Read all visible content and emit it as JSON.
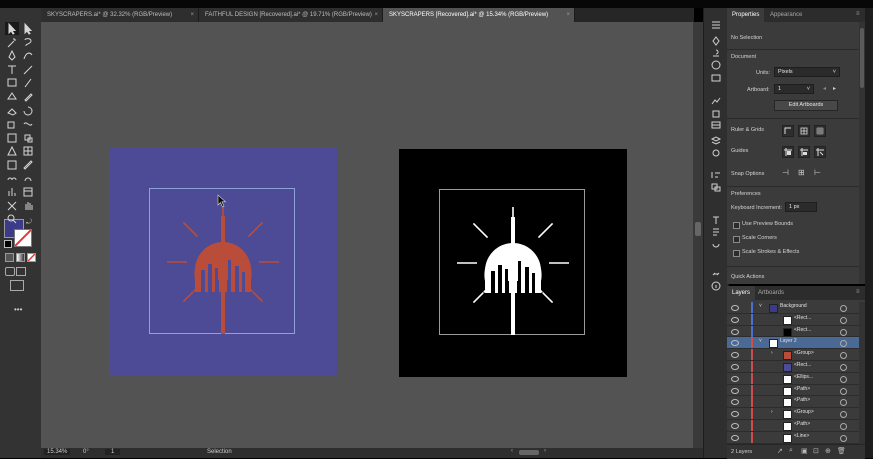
{
  "tabs": [
    {
      "label": "SKYSCRAPERS.ai* @ 32.32% (RGB/Preview)",
      "active": false
    },
    {
      "label": "FAITHFUL DESIGN [Recovered].ai* @ 19.71% (RGB/Preview)",
      "active": false
    },
    {
      "label": "SKYSCRAPERS [Recovered].ai* @ 15.34% (RGB/Preview)",
      "active": true
    }
  ],
  "tab_close": "×",
  "status": {
    "zoom": "15.34%",
    "angle": "0°",
    "artboard": "1",
    "tool": "Selection"
  },
  "panel": {
    "tab_properties": "Properties",
    "tab_appearance": "Appearance",
    "no_selection": "No Selection",
    "document_header": "Document",
    "units_label": "Units:",
    "units_value": "Pixels",
    "artboard_label": "Artboard:",
    "artboard_value": "1",
    "edit_artboards": "Edit Artboards",
    "ruler_grids": "Ruler & Grids",
    "guides": "Guides",
    "snap_options": "Snap Options",
    "preferences": "Preferences",
    "keyboard_increment_label": "Keyboard Increment:",
    "keyboard_increment_value": "1 px",
    "use_preview_bounds": "Use Preview Bounds",
    "scale_corners": "Scale Corners",
    "scale_strokes": "Scale Strokes & Effects",
    "quick_actions": "Quick Actions"
  },
  "layers_panel": {
    "tab_layers": "Layers",
    "tab_artboards": "Artboards",
    "rows": [
      {
        "name": "Background",
        "level": 0,
        "selected": false,
        "color": "#4f6fcf",
        "thumb": "#3b3b8a",
        "expander": "˅"
      },
      {
        "name": "<Rect...",
        "level": 1,
        "selected": false,
        "color": "#4f6fcf",
        "thumb": "#ffffff",
        "expander": ""
      },
      {
        "name": "<Rect...",
        "level": 1,
        "selected": false,
        "color": "#4f6fcf",
        "thumb": "#000000",
        "expander": ""
      },
      {
        "name": "Layer 2",
        "level": 0,
        "selected": true,
        "color": "#d04b4b",
        "thumb": "#ffffff",
        "expander": "˅"
      },
      {
        "name": "<Group>",
        "level": 1,
        "selected": false,
        "color": "#d04b4b",
        "thumb": "#b94d3a",
        "expander": "›"
      },
      {
        "name": "<Rect...",
        "level": 1,
        "selected": false,
        "color": "#d04b4b",
        "thumb": "#4d4a96",
        "expander": ""
      },
      {
        "name": "<Ellips...",
        "level": 1,
        "selected": false,
        "color": "#d04b4b",
        "thumb": "#ffffff",
        "expander": ""
      },
      {
        "name": "<Path>",
        "level": 1,
        "selected": false,
        "color": "#d04b4b",
        "thumb": "#ffffff",
        "expander": ""
      },
      {
        "name": "<Path>",
        "level": 1,
        "selected": false,
        "color": "#d04b4b",
        "thumb": "#ffffff",
        "expander": ""
      },
      {
        "name": "<Group>",
        "level": 1,
        "selected": false,
        "color": "#d04b4b",
        "thumb": "#ffffff",
        "expander": "›"
      },
      {
        "name": "<Path>",
        "level": 1,
        "selected": false,
        "color": "#d04b4b",
        "thumb": "#ffffff",
        "expander": ""
      },
      {
        "name": "<Line>",
        "level": 1,
        "selected": false,
        "color": "#d04b4b",
        "thumb": "#ffffff",
        "expander": ""
      }
    ],
    "footer_count": "2 Layers"
  },
  "artboards": [
    {
      "name": "artboard-blue",
      "bg": "#4d4a96",
      "logo_color": "#b94d3a"
    },
    {
      "name": "artboard-black",
      "bg": "#000000",
      "logo_color": "#ffffff"
    }
  ],
  "colors": {
    "fill_swatch": "#3b3b8a",
    "ui_bg": "#535353",
    "accent_select": "#4a6a95"
  },
  "icons": {
    "toolbar": [
      "selection-tool-icon",
      "direct-selection-tool-icon",
      "magic-wand-icon",
      "lasso-icon",
      "pen-tool-icon",
      "curvature-icon",
      "type-tool-icon",
      "line-tool-icon",
      "rectangle-tool-icon",
      "paintbrush-icon",
      "shaper-icon",
      "pencil-icon",
      "eraser-icon",
      "rotate-icon",
      "scale-icon",
      "warp-icon",
      "free-transform-icon",
      "shape-builder-icon",
      "perspective-icon",
      "mesh-icon",
      "gradient-icon",
      "eyedropper-icon",
      "blend-icon",
      "symbol-sprayer-icon",
      "column-graph-icon",
      "artboard-tool-icon",
      "slice-icon",
      "hand-icon",
      "zoom-icon"
    ],
    "side_strip": [
      "panel-menu-icon",
      "puppet-icon",
      "clubs-icon",
      "color-wheel-icon",
      "cc-libraries-icon",
      "image-trace-icon",
      "transparency-icon",
      "gradient-panel-icon",
      "layers-stack-icon",
      "appearance-icon",
      "align-icon",
      "pathfinder-icon",
      "type-panel-icon",
      "paragraph-icon",
      "opentype-icon",
      "links-icon",
      "info-icon"
    ]
  }
}
